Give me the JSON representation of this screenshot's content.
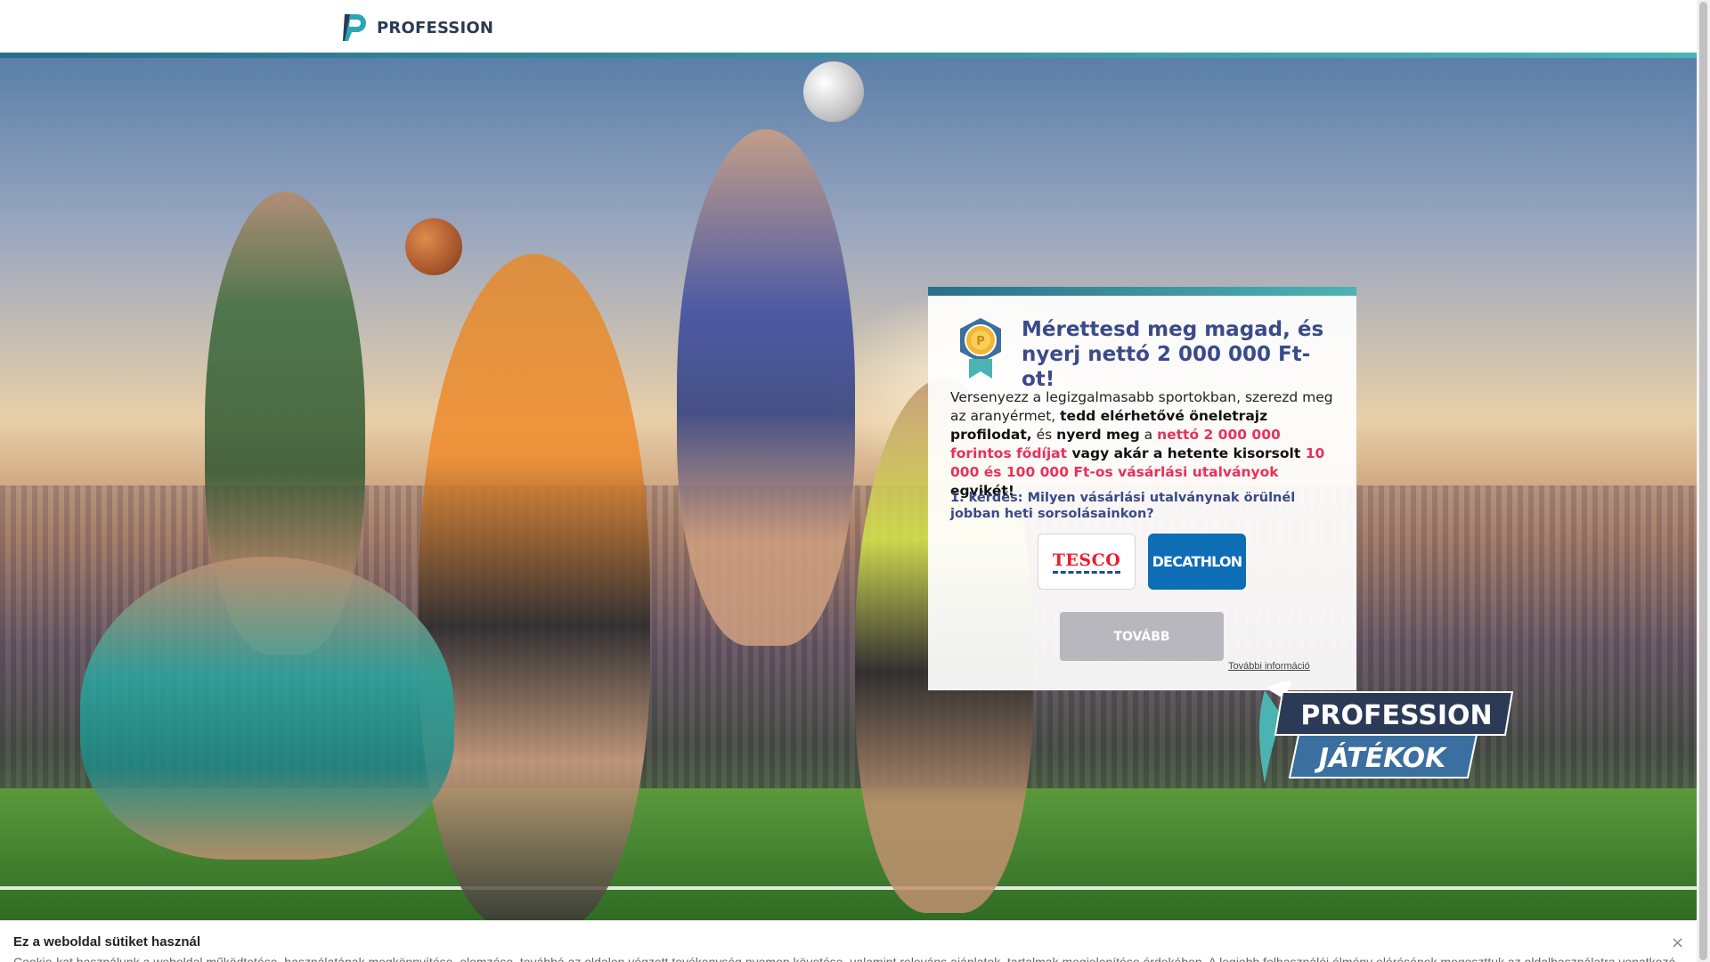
{
  "header": {
    "logo_text": "PROFESSION"
  },
  "card": {
    "title": "Mérettesd meg magad, és nyerj nettó 2 000 000 Ft-ot!",
    "body": {
      "t1": "Versenyezz a legizgalmasabb sportokban, szerezd meg az aranyérmet, ",
      "b1": "tedd elérhetővé öneletrajz profilodat,",
      "t2": " és ",
      "b2": "nyerd meg",
      "t3": " a ",
      "h1": "nettó 2 000 000 forintos fődíjat",
      "b3": " vagy akár a hetente kisorsolt ",
      "h2": "10 000 és 100 000 Ft-os vásárlási utalványok",
      "b4": " egyikét!"
    },
    "question": "1. kérdés: Milyen vásárlási utalványnak örülnél jobban heti sorsolásainkon?",
    "options": [
      {
        "label": "TESCO"
      },
      {
        "label": "DECATHLON"
      }
    ],
    "next_label": "TOVÁBB",
    "more_info": "További információ"
  },
  "games_logo": {
    "line1": "PROFESSION",
    "line2": "JÁTÉKOK"
  },
  "cookie": {
    "title": "Ez a weboldal sütiket használ",
    "text": "Cookie-kat használunk a weboldal működtetése, használatának megkönnyítése, elemzése, továbbá az oldalon végzett tevékenység nyomon követése, valamint releváns ajánlatok, tartalmak megjelenítése érdekében. A legjobb felhasználói élmény elérésének megoszttuk az oldalhasználatra vonatkozó",
    "close": "×"
  },
  "colors": {
    "accent": "#3a4a8a",
    "highlight": "#e8315a",
    "tesco_red": "#ee1c2e",
    "decathlon_blue": "#0d6eb5",
    "button_gray": "#b7b7bd"
  }
}
